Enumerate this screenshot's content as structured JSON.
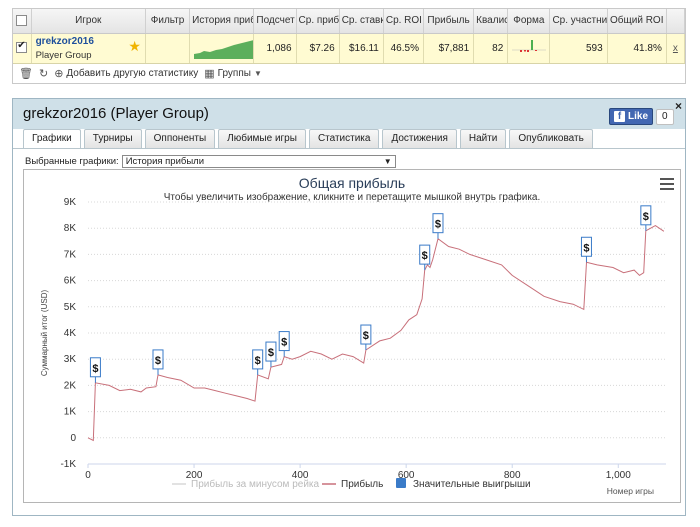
{
  "stats": {
    "headers": [
      "",
      "Игрок",
      "Фильтр",
      "История приб",
      "Подсчет",
      "Ср. приб",
      "Ср. ставк",
      "Ср. ROI",
      "Прибыль",
      "Квалис",
      "Форма",
      "Ср. участни",
      "Общий ROI",
      ""
    ],
    "row": {
      "player_name": "grekzor2016",
      "player_group": "Player Group",
      "count": "1,086",
      "avg_profit": "$7.26",
      "avg_stake": "$16.11",
      "avg_roi": "46.5%",
      "profit": "$7,881",
      "quals": "82",
      "avg_entrants": "593",
      "total_roi": "41.8%",
      "remove_label": "x"
    },
    "toolbar": {
      "add_stats": "Добавить другую статистику",
      "groups": "Группы"
    }
  },
  "main": {
    "title": "grekzor2016 (Player Group)",
    "close": "×",
    "fb_like": "Like",
    "fb_count": "0",
    "tabs": [
      "Графики",
      "Турниры",
      "Оппоненты",
      "Любимые игры",
      "Статистика",
      "Достижения",
      "Найти",
      "Опубликовать"
    ],
    "active_tab": 0,
    "graph_select_label": "Выбранные графики:",
    "graph_select_value": "История прибыли"
  },
  "chart_data": {
    "type": "line",
    "title": "Общая прибыль",
    "subtitle": "Чтобы увеличить изображение, кликните и перетащите мышкой внутрь графика.",
    "xlabel": "Номер игры",
    "ylabel": "Суммарный итог (USD)",
    "xlim": [
      0,
      1090
    ],
    "ylim": [
      -1000,
      9000
    ],
    "x_ticks": [
      0,
      200,
      400,
      600,
      800,
      1000
    ],
    "x_tick_labels": [
      "0",
      "200",
      "400",
      "600",
      "800",
      "1,000"
    ],
    "y_ticks": [
      -1000,
      0,
      1000,
      2000,
      3000,
      4000,
      5000,
      6000,
      7000,
      8000,
      9000
    ],
    "y_tick_labels": [
      "-1K",
      "0",
      "1K",
      "2K",
      "3K",
      "4K",
      "5K",
      "6K",
      "7K",
      "8K",
      "9K"
    ],
    "grid": "horizontal-dotted",
    "legend_position": "bottom",
    "colors": {
      "profit": "#c8707a",
      "profit_without_rake": "#d9d9d9",
      "big_wins": "#3a7bc8"
    },
    "series": [
      {
        "name": "Прибыль за минусом рейка",
        "values": []
      },
      {
        "name": "Прибыль",
        "points": [
          [
            0,
            0
          ],
          [
            10,
            -100
          ],
          [
            14,
            2100
          ],
          [
            40,
            2000
          ],
          [
            60,
            1800
          ],
          [
            80,
            1850
          ],
          [
            100,
            1750
          ],
          [
            110,
            1900
          ],
          [
            128,
            1950
          ],
          [
            132,
            2400
          ],
          [
            150,
            2300
          ],
          [
            175,
            2200
          ],
          [
            200,
            1900
          ],
          [
            220,
            1900
          ],
          [
            240,
            1800
          ],
          [
            260,
            1700
          ],
          [
            280,
            1600
          ],
          [
            300,
            1500
          ],
          [
            315,
            1400
          ],
          [
            320,
            2400
          ],
          [
            340,
            2250
          ],
          [
            345,
            2700
          ],
          [
            365,
            2800
          ],
          [
            370,
            3100
          ],
          [
            385,
            3000
          ],
          [
            400,
            3100
          ],
          [
            420,
            3300
          ],
          [
            440,
            3200
          ],
          [
            460,
            3000
          ],
          [
            480,
            3200
          ],
          [
            500,
            3100
          ],
          [
            520,
            2850
          ],
          [
            524,
            3350
          ],
          [
            550,
            3700
          ],
          [
            570,
            3800
          ],
          [
            590,
            4100
          ],
          [
            605,
            4500
          ],
          [
            620,
            4700
          ],
          [
            630,
            5300
          ],
          [
            635,
            6400
          ],
          [
            640,
            6600
          ],
          [
            645,
            6500
          ],
          [
            650,
            6800
          ],
          [
            660,
            7600
          ],
          [
            680,
            7300
          ],
          [
            700,
            7200
          ],
          [
            720,
            7000
          ],
          [
            750,
            6800
          ],
          [
            780,
            6600
          ],
          [
            800,
            6200
          ],
          [
            830,
            5800
          ],
          [
            860,
            5400
          ],
          [
            890,
            5200
          ],
          [
            915,
            5100
          ],
          [
            935,
            4900
          ],
          [
            940,
            6700
          ],
          [
            960,
            6600
          ],
          [
            990,
            6500
          ],
          [
            1010,
            6300
          ],
          [
            1030,
            6400
          ],
          [
            1040,
            6200
          ],
          [
            1048,
            6300
          ],
          [
            1052,
            7900
          ],
          [
            1070,
            8100
          ],
          [
            1086,
            7881
          ]
        ]
      }
    ],
    "big_wins": [
      {
        "x": 14,
        "y": 2100,
        "label": "$"
      },
      {
        "x": 132,
        "y": 2400,
        "label": "$"
      },
      {
        "x": 320,
        "y": 2400,
        "label": "$"
      },
      {
        "x": 345,
        "y": 2700,
        "label": "$"
      },
      {
        "x": 370,
        "y": 3100,
        "label": "$"
      },
      {
        "x": 524,
        "y": 3350,
        "label": "$"
      },
      {
        "x": 635,
        "y": 6400,
        "label": "$"
      },
      {
        "x": 660,
        "y": 7600,
        "label": "$"
      },
      {
        "x": 940,
        "y": 6700,
        "label": "$"
      },
      {
        "x": 1052,
        "y": 7900,
        "label": "$"
      }
    ],
    "legend": [
      "Прибыль за минусом рейка",
      "Прибыль",
      "Значительные выигрыши"
    ]
  }
}
